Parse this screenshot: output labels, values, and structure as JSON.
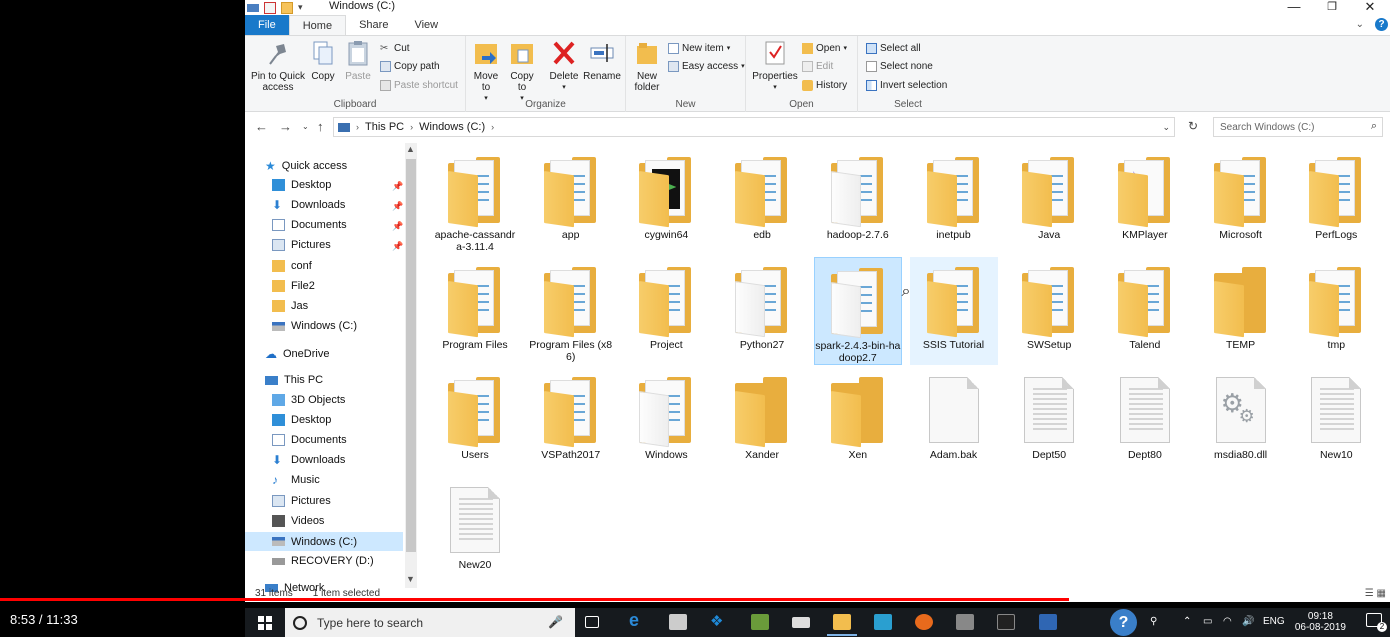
{
  "window": {
    "title": "Windows (C:)",
    "controls": [
      "—",
      "❐",
      "✕"
    ]
  },
  "tabs": [
    {
      "label": "File"
    },
    {
      "label": "Home"
    },
    {
      "label": "Share"
    },
    {
      "label": "View"
    }
  ],
  "ribbon": {
    "clipboard": {
      "label": "Clipboard",
      "pin": "Pin to Quick access",
      "copy": "Copy",
      "paste": "Paste",
      "cut": "Cut",
      "copy_path": "Copy path",
      "paste_shortcut": "Paste shortcut"
    },
    "organize": {
      "label": "Organize",
      "move_to": "Move to",
      "copy_to": "Copy to",
      "delete": "Delete",
      "rename": "Rename"
    },
    "new": {
      "label": "New",
      "new_folder": "New folder",
      "new_item": "New item",
      "easy_access": "Easy access"
    },
    "open": {
      "label": "Open",
      "properties": "Properties",
      "open": "Open",
      "edit": "Edit",
      "history": "History"
    },
    "select": {
      "label": "Select",
      "select_all": "Select all",
      "select_none": "Select none",
      "invert": "Invert selection"
    }
  },
  "address": {
    "crumbs": [
      "This PC",
      "Windows (C:)"
    ],
    "search_placeholder": "Search Windows (C:)"
  },
  "sidebar": {
    "quick_access": "Quick access",
    "quick_items": [
      "Desktop",
      "Downloads",
      "Documents",
      "Pictures",
      "conf",
      "File2",
      "Jas",
      "Windows (C:)"
    ],
    "onedrive": "OneDrive",
    "this_pc": "This PC",
    "pc_items": [
      "3D Objects",
      "Desktop",
      "Documents",
      "Downloads",
      "Music",
      "Pictures",
      "Videos",
      "Windows (C:)",
      "RECOVERY (D:)"
    ],
    "network": "Network"
  },
  "files": [
    {
      "name": "apache-cassandra-3.11.4",
      "type": "folder"
    },
    {
      "name": "app",
      "type": "folder"
    },
    {
      "name": "cygwin64",
      "type": "folder-cygwin"
    },
    {
      "name": "edb",
      "type": "folder"
    },
    {
      "name": "hadoop-2.7.6",
      "type": "folder-light"
    },
    {
      "name": "inetpub",
      "type": "folder"
    },
    {
      "name": "Java",
      "type": "folder"
    },
    {
      "name": "KMPlayer",
      "type": "folder-km"
    },
    {
      "name": "Microsoft",
      "type": "folder"
    },
    {
      "name": "PerfLogs",
      "type": "folder"
    },
    {
      "name": "Program Files",
      "type": "folder"
    },
    {
      "name": "Program Files (x86)",
      "type": "folder"
    },
    {
      "name": "Project",
      "type": "folder"
    },
    {
      "name": "Python27",
      "type": "folder-light"
    },
    {
      "name": "spark-2.4.3-bin-hadoop2.7",
      "type": "folder-light",
      "state": "selected"
    },
    {
      "name": "SSIS Tutorial",
      "type": "folder",
      "state": "hover"
    },
    {
      "name": "SWSetup",
      "type": "folder"
    },
    {
      "name": "Talend",
      "type": "folder"
    },
    {
      "name": "TEMP",
      "type": "folder-empty"
    },
    {
      "name": "tmp",
      "type": "folder"
    },
    {
      "name": "Users",
      "type": "folder"
    },
    {
      "name": "VSPath2017",
      "type": "folder"
    },
    {
      "name": "Windows",
      "type": "folder-light"
    },
    {
      "name": "Xander",
      "type": "folder-empty"
    },
    {
      "name": "Xen",
      "type": "folder-empty"
    },
    {
      "name": "Adam.bak",
      "type": "file-blank"
    },
    {
      "name": "Dept50",
      "type": "file"
    },
    {
      "name": "Dept80",
      "type": "file"
    },
    {
      "name": "msdia80.dll",
      "type": "file-dll"
    },
    {
      "name": "New10",
      "type": "file"
    },
    {
      "name": "New20",
      "type": "file"
    }
  ],
  "status": {
    "count": "31 items",
    "selected": "1 item selected"
  },
  "player": {
    "time": "8:53 / 11:33",
    "progress": 0.769
  },
  "taskbar": {
    "search_placeholder": "Type here to search",
    "lang": "ENG",
    "time": "09:18",
    "date": "06-08-2019",
    "notif_count": "2"
  },
  "colors": {
    "accent": "#1979ca",
    "folder": "#f2bd4e",
    "selection": "#cce8ff",
    "progress": "#ff0000"
  }
}
